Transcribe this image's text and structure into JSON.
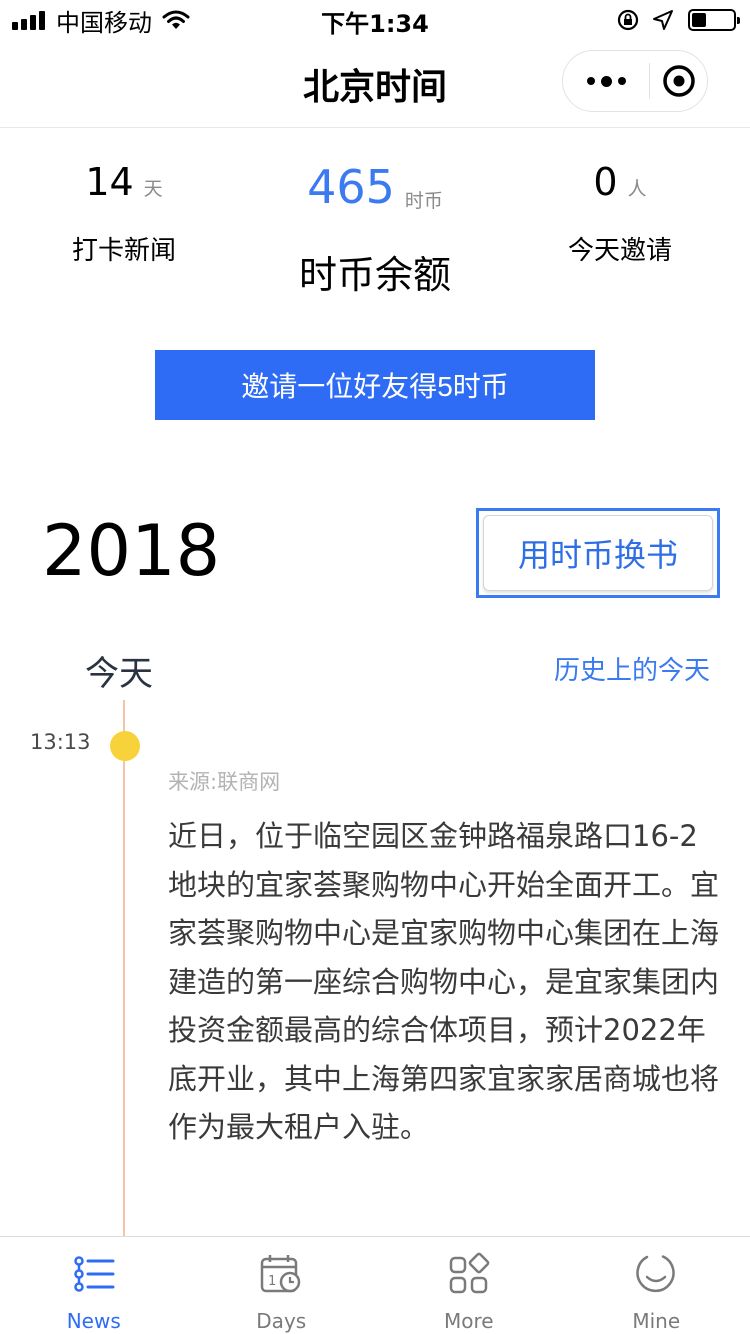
{
  "status_bar": {
    "carrier": "中国移动",
    "time": "下午1:34",
    "battery_level": 0.35
  },
  "nav": {
    "title": "北京时间"
  },
  "stats": {
    "checkin": {
      "value": "14",
      "unit": "天",
      "label": "打卡新闻"
    },
    "balance": {
      "value": "465",
      "unit": "时币",
      "label": "时币余额"
    },
    "invites": {
      "value": "0",
      "unit": "人",
      "label": "今天邀请"
    }
  },
  "invite_button": "邀请一位好友得5时币",
  "year": "2018",
  "exchange_button": "用时币换书",
  "section": {
    "title": "今天",
    "history_link": "历史上的今天"
  },
  "news_item": {
    "time": "13:13",
    "source": "来源:联商网",
    "body": "近日，位于临空园区金钟路福泉路口16-2地块的宜家荟聚购物中心开始全面开工。宜家荟聚购物中心是宜家购物中心集团在上海建造的第一座综合购物中心，是宜家集团内投资金额最高的综合体项目，预计2022年底开业，其中上海第四家宜家家居商城也将作为最大租户入驻。"
  },
  "tabs": [
    {
      "label": "News",
      "icon": "list-icon",
      "active": true
    },
    {
      "label": "Days",
      "icon": "calendar-icon",
      "active": false
    },
    {
      "label": "More",
      "icon": "grid-icon",
      "active": false
    },
    {
      "label": "Mine",
      "icon": "smiley-icon",
      "active": false
    }
  ],
  "colors": {
    "accent": "#2e6cf6",
    "accent_text": "#3b7af0",
    "timeline_dot": "#f7d23a",
    "timeline_line": "#f3c4a8"
  }
}
